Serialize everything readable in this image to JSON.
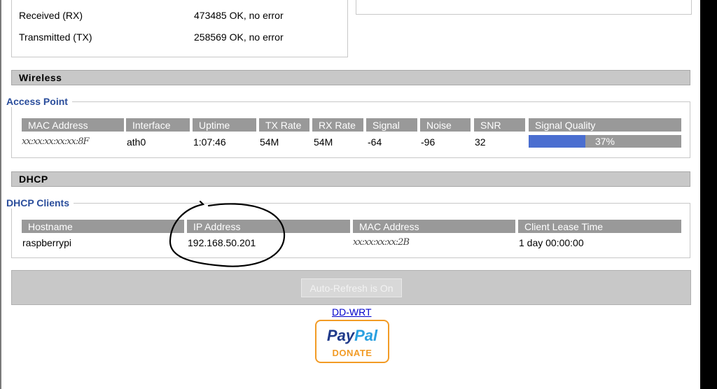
{
  "interface_stats": {
    "received_label": "Received (RX)",
    "received_value": "473485 OK, no error",
    "transmitted_label": "Transmitted (TX)",
    "transmitted_value": "258569 OK, no error"
  },
  "wireless": {
    "section_title": "Wireless",
    "legend": "Access Point",
    "headers": [
      "MAC Address",
      "Interface",
      "Uptime",
      "TX Rate",
      "RX Rate",
      "Signal",
      "Noise",
      "SNR",
      "Signal Quality"
    ],
    "row": {
      "mac": "xx:xx:xx:xx:xx:8F",
      "interface": "ath0",
      "uptime": "1:07:46",
      "tx_rate": "54M",
      "rx_rate": "54M",
      "signal": "-64",
      "noise": "-96",
      "snr": "32",
      "signal_quality_text": "37%",
      "signal_quality_fraction": 0.37
    }
  },
  "dhcp": {
    "section_title": "DHCP",
    "legend": "DHCP Clients",
    "headers": [
      "Hostname",
      "IP Address",
      "MAC Address",
      "Client Lease Time"
    ],
    "row": {
      "hostname": "raspberrypi",
      "ip": "192.168.50.201",
      "mac": "xx:xx:xx:xx:2B",
      "lease": "1 day 00:00:00"
    }
  },
  "footer": {
    "refresh_label": "Auto-Refresh is On",
    "link_label": "DD-WRT",
    "paypal_word1": "Pay",
    "paypal_word2": "Pal",
    "paypal_donate": "DONATE"
  },
  "colors": {
    "accent_legend": "#2a4d9b",
    "quality_fill": "#4a6ed0",
    "header_bg": "#999999",
    "section_bg": "#c8c8c8"
  }
}
